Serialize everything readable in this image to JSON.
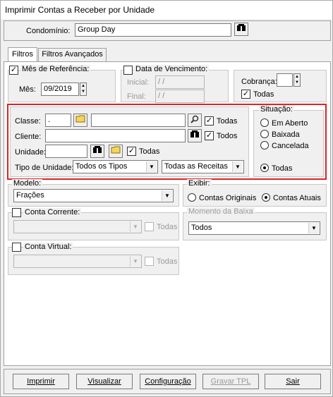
{
  "window": {
    "title": "Imprimir Contas a Receber por Unidade"
  },
  "condominio": {
    "label": "Condomínio:",
    "value": "Group Day"
  },
  "tabs": [
    {
      "label": "Filtros"
    },
    {
      "label": "Filtros Avançados"
    }
  ],
  "mes_referencia": {
    "label": "Mês de Referência:",
    "checked": true,
    "mes_label": "Mês:",
    "mes_value": "09/2019"
  },
  "data_vencimento": {
    "label": "Data de Vencimento:",
    "inicial_label": "Inicial:",
    "inicial_value": "/ /",
    "final_label": "Final:",
    "final_value": "/ /"
  },
  "cobranca": {
    "label": "Cobrança:",
    "value": "",
    "todas_label": "Todas"
  },
  "classe": {
    "label": "Classe:",
    "code": ".",
    "value": "",
    "todas_label": "Todas"
  },
  "cliente": {
    "label": "Cliente:",
    "value": "",
    "todos_label": "Todos"
  },
  "unidade": {
    "label": "Unidade:",
    "value": "",
    "todas_label": "Todas"
  },
  "tipo_unidade": {
    "label": "Tipo de Unidade:",
    "value": "Todos os Tipos",
    "receitas_value": "Todas as Receitas"
  },
  "situacao": {
    "label": "Situação:",
    "options": [
      "Em Aberto",
      "Baixada",
      "Cancelada",
      "Todas"
    ],
    "selected": "Todas"
  },
  "modelo": {
    "label": "Modelo:",
    "value": "Frações"
  },
  "exibir": {
    "label": "Exibir:",
    "options": [
      "Contas Originais",
      "Contas Atuais"
    ],
    "selected": "Contas Atuais"
  },
  "conta_corrente": {
    "label": "Conta Corrente:",
    "value": "",
    "todas_label": "Todas"
  },
  "momento_baixa": {
    "label": "Momento da Baixa",
    "value": "Todos"
  },
  "conta_virtual": {
    "label": "Conta Virtual:",
    "value": "",
    "todas_label": "Todas"
  },
  "buttons": {
    "imprimir": "Imprimir",
    "visualizar": "Visualizar",
    "configuracao": "Configuração",
    "gravar_tpl": "Gravar TPL",
    "sair": "Sair"
  },
  "colors": {
    "highlight": "#e02020"
  }
}
